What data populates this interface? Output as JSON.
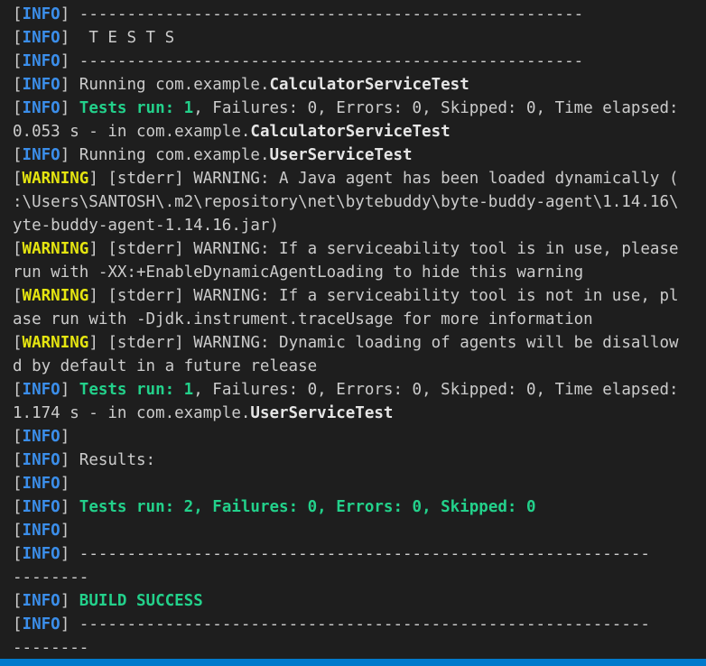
{
  "colors": {
    "background": "#1e1e1e",
    "default_text": "#cccccc",
    "info": "#3b8eea",
    "warning": "#e5e510",
    "success": "#23d18b",
    "status_bar": "#007acc"
  },
  "lines": [
    [
      [
        "br",
        "["
      ],
      [
        "info",
        "INFO"
      ],
      [
        "br",
        "] "
      ],
      [
        "plain",
        "-----------------------------------------------------"
      ]
    ],
    [
      [
        "br",
        "["
      ],
      [
        "info",
        "INFO"
      ],
      [
        "br",
        "] "
      ],
      [
        "plain",
        " T E S T S"
      ]
    ],
    [
      [
        "br",
        "["
      ],
      [
        "info",
        "INFO"
      ],
      [
        "br",
        "] "
      ],
      [
        "plain",
        "-----------------------------------------------------"
      ]
    ],
    [
      [
        "br",
        "["
      ],
      [
        "info",
        "INFO"
      ],
      [
        "br",
        "] "
      ],
      [
        "plain",
        "Running com.example."
      ],
      [
        "bold",
        "CalculatorServiceTest"
      ]
    ],
    [
      [
        "br",
        "["
      ],
      [
        "info",
        "INFO"
      ],
      [
        "br",
        "] "
      ],
      [
        "green",
        "Tests run: 1"
      ],
      [
        "plain",
        ", Failures: 0, Errors: 0, Skipped: 0, Time elapsed:"
      ]
    ],
    [
      [
        "plain",
        "0.053 s - in com.example."
      ],
      [
        "bold",
        "CalculatorServiceTest"
      ]
    ],
    [
      [
        "br",
        "["
      ],
      [
        "info",
        "INFO"
      ],
      [
        "br",
        "] "
      ],
      [
        "plain",
        "Running com.example."
      ],
      [
        "bold",
        "UserServiceTest"
      ]
    ],
    [
      [
        "br",
        "["
      ],
      [
        "warn",
        "WARNING"
      ],
      [
        "br",
        "] "
      ],
      [
        "plain",
        "[stderr] WARNING: A Java agent has been loaded dynamically ("
      ]
    ],
    [
      [
        "plain",
        ":\\Users\\SANTOSH\\.m2\\repository\\net\\bytebuddy\\byte-buddy-agent\\1.14.16\\"
      ]
    ],
    [
      [
        "plain",
        "yte-buddy-agent-1.14.16.jar)"
      ]
    ],
    [
      [
        "br",
        "["
      ],
      [
        "warn",
        "WARNING"
      ],
      [
        "br",
        "] "
      ],
      [
        "plain",
        "[stderr] WARNING: If a serviceability tool is in use, please"
      ]
    ],
    [
      [
        "plain",
        "run with -XX:+EnableDynamicAgentLoading to hide this warning"
      ]
    ],
    [
      [
        "br",
        "["
      ],
      [
        "warn",
        "WARNING"
      ],
      [
        "br",
        "] "
      ],
      [
        "plain",
        "[stderr] WARNING: If a serviceability tool is not in use, pl"
      ]
    ],
    [
      [
        "plain",
        "ase run with -Djdk.instrument.traceUsage for more information"
      ]
    ],
    [
      [
        "br",
        "["
      ],
      [
        "warn",
        "WARNING"
      ],
      [
        "br",
        "] "
      ],
      [
        "plain",
        "[stderr] WARNING: Dynamic loading of agents will be disallow"
      ]
    ],
    [
      [
        "plain",
        "d by default in a future release"
      ]
    ],
    [
      [
        "br",
        "["
      ],
      [
        "info",
        "INFO"
      ],
      [
        "br",
        "] "
      ],
      [
        "green",
        "Tests run: 1"
      ],
      [
        "plain",
        ", Failures: 0, Errors: 0, Skipped: 0, Time elapsed:"
      ]
    ],
    [
      [
        "plain",
        "1.174 s - in com.example."
      ],
      [
        "bold",
        "UserServiceTest"
      ]
    ],
    [
      [
        "br",
        "["
      ],
      [
        "info",
        "INFO"
      ],
      [
        "br",
        "]"
      ]
    ],
    [
      [
        "br",
        "["
      ],
      [
        "info",
        "INFO"
      ],
      [
        "br",
        "] "
      ],
      [
        "plain",
        "Results:"
      ]
    ],
    [
      [
        "br",
        "["
      ],
      [
        "info",
        "INFO"
      ],
      [
        "br",
        "]"
      ]
    ],
    [
      [
        "br",
        "["
      ],
      [
        "info",
        "INFO"
      ],
      [
        "br",
        "] "
      ],
      [
        "green",
        "Tests run: 2, Failures: 0, Errors: 0, Skipped: 0"
      ]
    ],
    [
      [
        "br",
        "["
      ],
      [
        "info",
        "INFO"
      ],
      [
        "br",
        "]"
      ]
    ],
    [
      [
        "br",
        "["
      ],
      [
        "info",
        "INFO"
      ],
      [
        "br",
        "] "
      ],
      [
        "plain",
        "------------------------------------------------------------"
      ]
    ],
    [
      [
        "plain",
        "--------"
      ]
    ],
    [
      [
        "br",
        "["
      ],
      [
        "info",
        "INFO"
      ],
      [
        "br",
        "] "
      ],
      [
        "green",
        "BUILD SUCCESS"
      ]
    ],
    [
      [
        "br",
        "["
      ],
      [
        "info",
        "INFO"
      ],
      [
        "br",
        "] "
      ],
      [
        "plain",
        "------------------------------------------------------------"
      ]
    ],
    [
      [
        "plain",
        "--------"
      ]
    ]
  ]
}
